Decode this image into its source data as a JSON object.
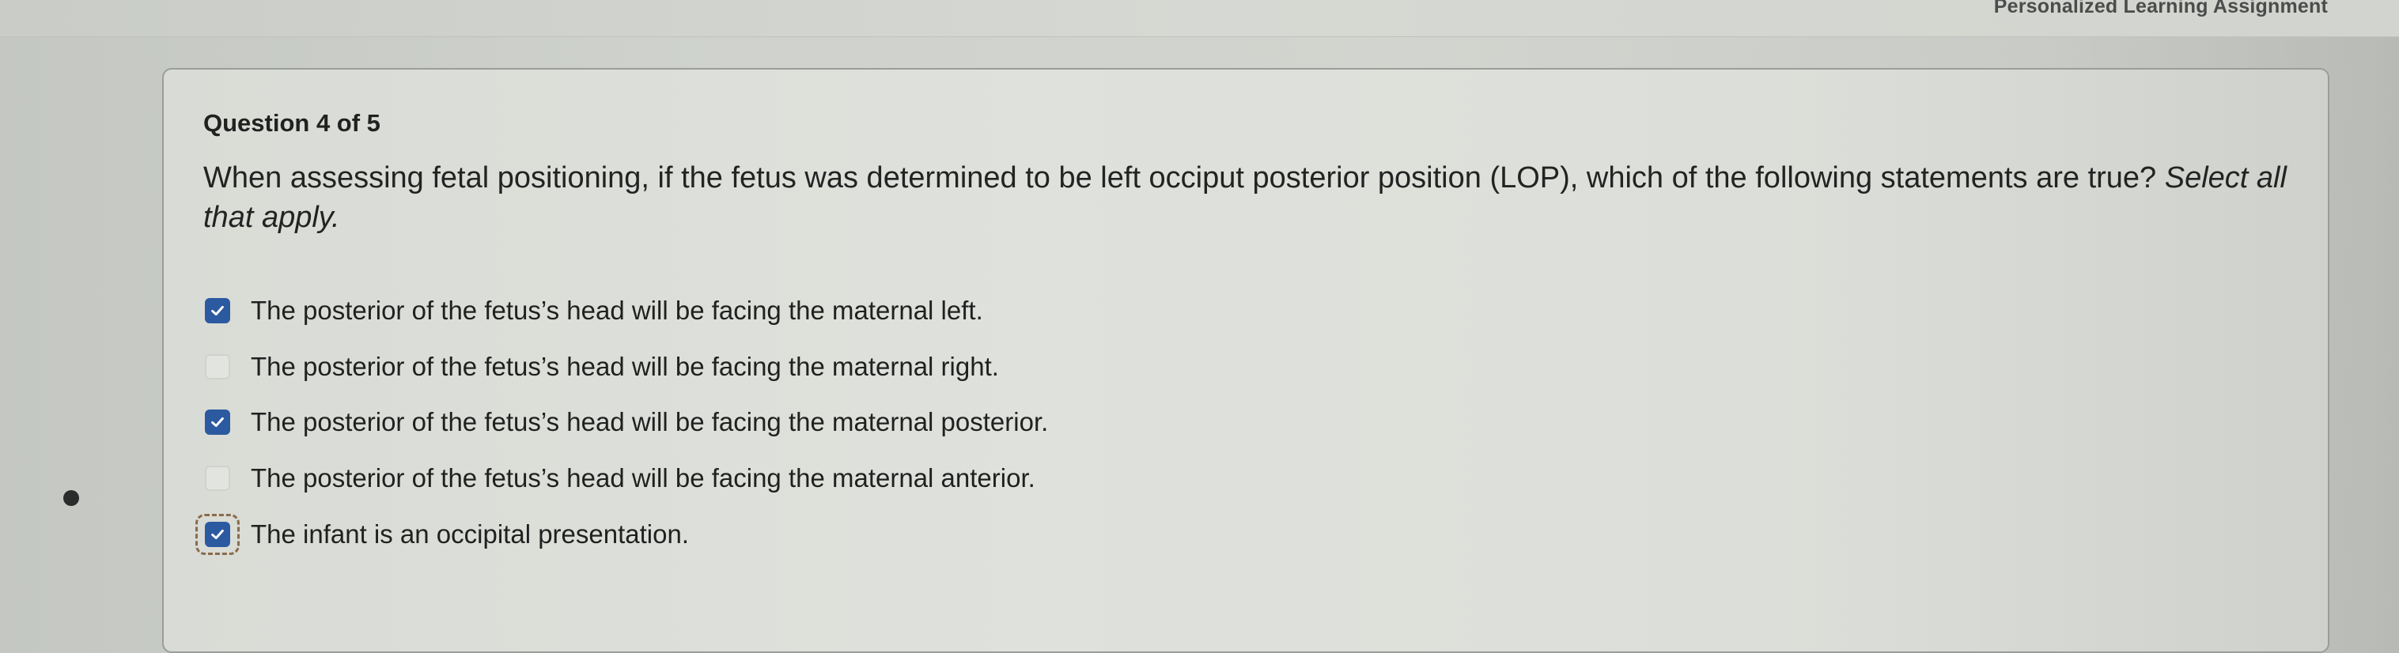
{
  "header": {
    "title": "Personalized Learning Assignment"
  },
  "question": {
    "counter": "Question 4 of 5",
    "text": "When assessing fetal positioning, if the fetus was determined to be left occiput posterior position (LOP), which of the following statements are true? ",
    "instruction": "Select all that apply.",
    "options": [
      {
        "label": "The posterior of the fetus’s head will be facing the maternal left.",
        "checked": true
      },
      {
        "label": "The posterior of the fetus’s head will be facing the maternal right.",
        "checked": false
      },
      {
        "label": "The posterior of the fetus’s head will be facing the maternal posterior.",
        "checked": true
      },
      {
        "label": "The posterior of the fetus’s head will be facing the maternal anterior.",
        "checked": false
      },
      {
        "label": "The infant is an occipital presentation.",
        "checked": true,
        "focused": true
      }
    ]
  },
  "colors": {
    "checkbox_checked": "#2c5aa0",
    "text": "#222423"
  },
  "icons": {
    "checked": "checkmark-icon"
  }
}
